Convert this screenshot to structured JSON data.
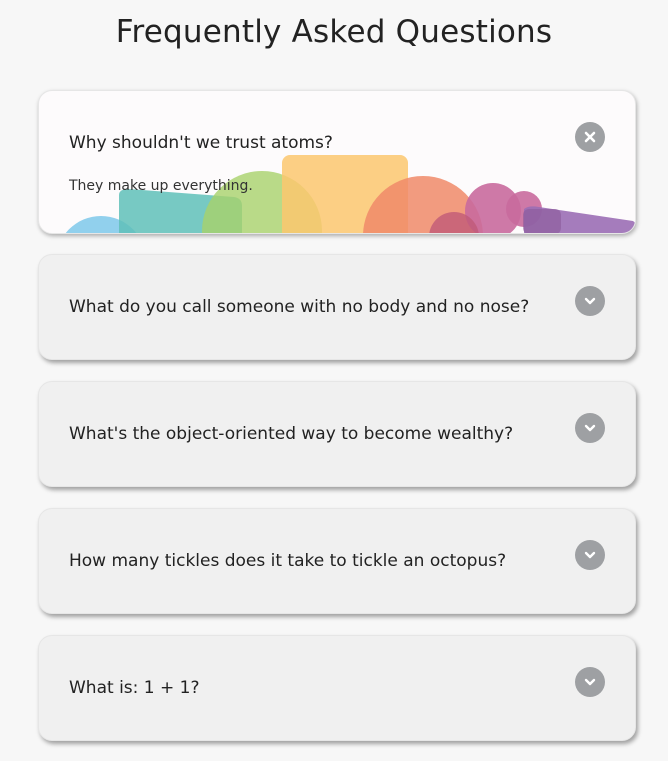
{
  "page": {
    "title": "Frequently Asked Questions"
  },
  "faqs": [
    {
      "question": "Why shouldn't we trust atoms?",
      "answer": "They make up everything.",
      "expanded": true,
      "toggle_icon": "close-icon"
    },
    {
      "question": "What do you call someone with no body and no nose?",
      "expanded": false,
      "toggle_icon": "chevron-down-icon"
    },
    {
      "question": "What's the object-oriented way to become wealthy?",
      "expanded": false,
      "toggle_icon": "chevron-down-icon"
    },
    {
      "question": "How many tickles does it take to tickle an octopus?",
      "expanded": false,
      "toggle_icon": "chevron-down-icon"
    },
    {
      "question": "What is: 1 + 1?",
      "expanded": false,
      "toggle_icon": "chevron-down-icon"
    }
  ],
  "colors": {
    "toggle_bg": "#9ea0a3",
    "card_bg": "#f0f0f0",
    "active_card_bg": "#fdfbfc",
    "shape_blue": "#7ec8ea",
    "shape_teal": "#5fbfb8",
    "shape_green": "#a8d26a",
    "shape_yellow": "#fcc76e",
    "shape_orange": "#f08a68",
    "shape_pink": "#c96a9d",
    "shape_purple": "#9b6eb5"
  }
}
